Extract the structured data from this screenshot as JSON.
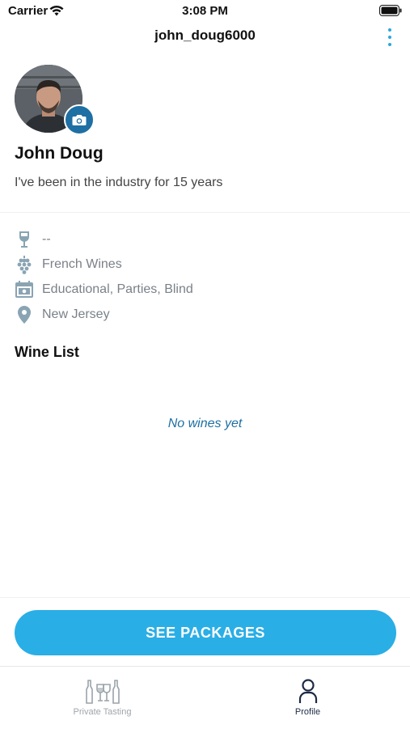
{
  "status_bar": {
    "carrier": "Carrier",
    "time": "3:08 PM"
  },
  "nav": {
    "title": "john_doug6000",
    "more_icon": "more-vertical-icon"
  },
  "profile": {
    "name": "John Doug",
    "bio": "I've been in the industry for 15 years",
    "camera_icon": "camera-icon"
  },
  "info": [
    {
      "icon": "wine-glass-icon",
      "text": "--"
    },
    {
      "icon": "grapes-icon",
      "text": "French Wines"
    },
    {
      "icon": "calendar-icon",
      "text": "Educational, Parties, Blind"
    },
    {
      "icon": "location-pin-icon",
      "text": "New Jersey"
    }
  ],
  "wine_list": {
    "title": "Wine List",
    "empty_text": "No wines yet"
  },
  "cta": {
    "label": "SEE PACKAGES"
  },
  "tabbar": {
    "tabs": [
      {
        "label": "Private Tasting",
        "icon": "wine-bottles-icon",
        "active": false
      },
      {
        "label": "Profile",
        "icon": "person-icon",
        "active": true
      }
    ]
  },
  "colors": {
    "accent": "#2AAEE6",
    "dark_blue": "#1E6FA3",
    "muted": "#7A8188"
  }
}
